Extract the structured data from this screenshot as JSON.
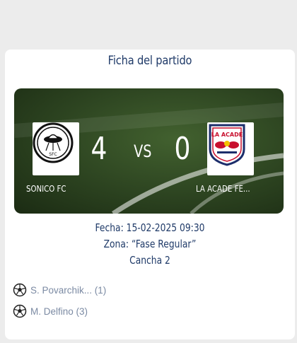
{
  "match_card": {
    "title": "Ficha del partido",
    "home": {
      "name": "SONICO FC",
      "score": "4",
      "logo_icon": "sonico-fc-crest-icon",
      "logo_text": "SFC"
    },
    "away": {
      "name": "LA ACADE FE...",
      "score": "0",
      "logo_icon": "la-acade-crest-icon",
      "logo_text": "LA ACADE"
    },
    "vs_label": "VS",
    "info": {
      "fecha": "Fecha: 15-02-2025 09:30",
      "zona": "Zona: “Fase Regular”",
      "cancha": "Cancha 2"
    },
    "scorers": [
      {
        "label": "S. Povarchik... (1)",
        "icon": "soccer-ball-icon"
      },
      {
        "label": "M. Delfino (3)",
        "icon": "soccer-ball-icon"
      }
    ],
    "colors": {
      "title": "#1f3a68",
      "scorer_text": "#7b8aa3",
      "pitch": "#2c4320"
    }
  }
}
